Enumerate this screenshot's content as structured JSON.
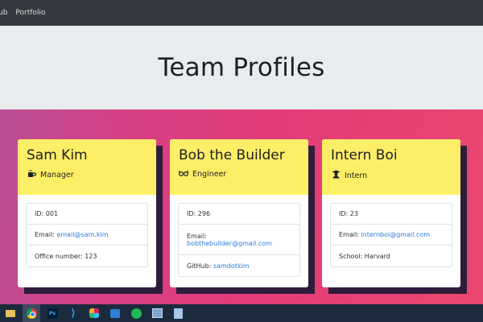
{
  "navbar": {
    "links": [
      "ub",
      "Portfolio"
    ]
  },
  "header": {
    "title": "Team Profiles"
  },
  "cards": [
    {
      "name": "Sam Kim",
      "role": "Manager",
      "role_icon": "coffee-mug-icon",
      "rows": [
        {
          "label": "ID: ",
          "value": "001"
        },
        {
          "label": "Email: ",
          "value": "email@sam.kim",
          "link": true
        },
        {
          "label": "Office number: ",
          "value": "123"
        }
      ]
    },
    {
      "name": "Bob the Builder",
      "role": "Engineer",
      "role_icon": "glasses-icon",
      "rows": [
        {
          "label": "ID: ",
          "value": "296"
        },
        {
          "label": "Email:",
          "value": "bobthebuilder@gmail.com",
          "link": true
        },
        {
          "label": "GitHub: ",
          "value": "samdotkim",
          "link": true
        }
      ]
    },
    {
      "name": "Intern Boi",
      "role": "Intern",
      "role_icon": "graduate-icon",
      "rows": [
        {
          "label": "ID: ",
          "value": "23"
        },
        {
          "label": "Email: ",
          "value": "internboi@gmail.com",
          "link": true
        },
        {
          "label": "School: ",
          "value": "Harvard"
        }
      ]
    }
  ],
  "colors": {
    "card_header": "#fdee67",
    "navbar": "#343a40",
    "jumbotron": "#e9ecef",
    "link": "#2b7bd8",
    "taskbar": "#1c2a3d"
  },
  "taskbar": {
    "icons": [
      "file-explorer-icon",
      "chrome-icon",
      "photoshop-icon",
      "vscode-icon",
      "slack-icon",
      "app-icon",
      "spotify-icon",
      "window-icon",
      "document-icon"
    ]
  }
}
